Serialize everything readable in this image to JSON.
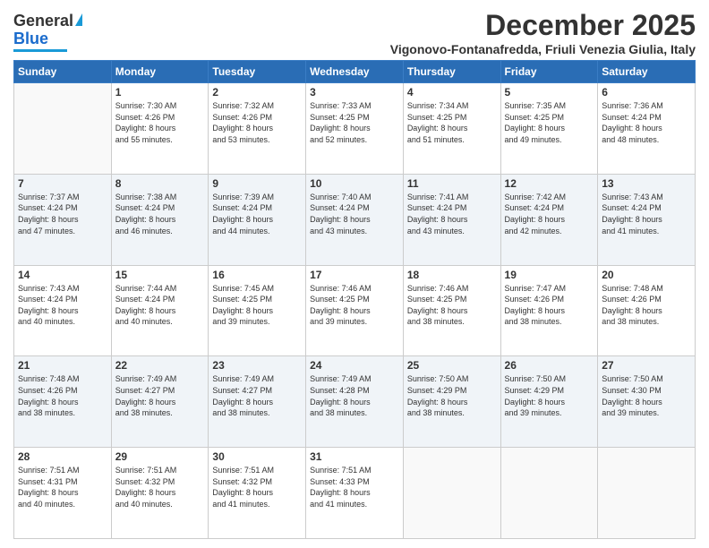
{
  "logo": {
    "line1": "General",
    "line2": "Blue"
  },
  "title": "December 2025",
  "location": "Vigonovo-Fontanafredda, Friuli Venezia Giulia, Italy",
  "days_header": [
    "Sunday",
    "Monday",
    "Tuesday",
    "Wednesday",
    "Thursday",
    "Friday",
    "Saturday"
  ],
  "weeks": [
    [
      {
        "day": "",
        "info": ""
      },
      {
        "day": "1",
        "info": "Sunrise: 7:30 AM\nSunset: 4:26 PM\nDaylight: 8 hours\nand 55 minutes."
      },
      {
        "day": "2",
        "info": "Sunrise: 7:32 AM\nSunset: 4:26 PM\nDaylight: 8 hours\nand 53 minutes."
      },
      {
        "day": "3",
        "info": "Sunrise: 7:33 AM\nSunset: 4:25 PM\nDaylight: 8 hours\nand 52 minutes."
      },
      {
        "day": "4",
        "info": "Sunrise: 7:34 AM\nSunset: 4:25 PM\nDaylight: 8 hours\nand 51 minutes."
      },
      {
        "day": "5",
        "info": "Sunrise: 7:35 AM\nSunset: 4:25 PM\nDaylight: 8 hours\nand 49 minutes."
      },
      {
        "day": "6",
        "info": "Sunrise: 7:36 AM\nSunset: 4:24 PM\nDaylight: 8 hours\nand 48 minutes."
      }
    ],
    [
      {
        "day": "7",
        "info": "Sunrise: 7:37 AM\nSunset: 4:24 PM\nDaylight: 8 hours\nand 47 minutes."
      },
      {
        "day": "8",
        "info": "Sunrise: 7:38 AM\nSunset: 4:24 PM\nDaylight: 8 hours\nand 46 minutes."
      },
      {
        "day": "9",
        "info": "Sunrise: 7:39 AM\nSunset: 4:24 PM\nDaylight: 8 hours\nand 44 minutes."
      },
      {
        "day": "10",
        "info": "Sunrise: 7:40 AM\nSunset: 4:24 PM\nDaylight: 8 hours\nand 43 minutes."
      },
      {
        "day": "11",
        "info": "Sunrise: 7:41 AM\nSunset: 4:24 PM\nDaylight: 8 hours\nand 43 minutes."
      },
      {
        "day": "12",
        "info": "Sunrise: 7:42 AM\nSunset: 4:24 PM\nDaylight: 8 hours\nand 42 minutes."
      },
      {
        "day": "13",
        "info": "Sunrise: 7:43 AM\nSunset: 4:24 PM\nDaylight: 8 hours\nand 41 minutes."
      }
    ],
    [
      {
        "day": "14",
        "info": "Sunrise: 7:43 AM\nSunset: 4:24 PM\nDaylight: 8 hours\nand 40 minutes."
      },
      {
        "day": "15",
        "info": "Sunrise: 7:44 AM\nSunset: 4:24 PM\nDaylight: 8 hours\nand 40 minutes."
      },
      {
        "day": "16",
        "info": "Sunrise: 7:45 AM\nSunset: 4:25 PM\nDaylight: 8 hours\nand 39 minutes."
      },
      {
        "day": "17",
        "info": "Sunrise: 7:46 AM\nSunset: 4:25 PM\nDaylight: 8 hours\nand 39 minutes."
      },
      {
        "day": "18",
        "info": "Sunrise: 7:46 AM\nSunset: 4:25 PM\nDaylight: 8 hours\nand 38 minutes."
      },
      {
        "day": "19",
        "info": "Sunrise: 7:47 AM\nSunset: 4:26 PM\nDaylight: 8 hours\nand 38 minutes."
      },
      {
        "day": "20",
        "info": "Sunrise: 7:48 AM\nSunset: 4:26 PM\nDaylight: 8 hours\nand 38 minutes."
      }
    ],
    [
      {
        "day": "21",
        "info": "Sunrise: 7:48 AM\nSunset: 4:26 PM\nDaylight: 8 hours\nand 38 minutes."
      },
      {
        "day": "22",
        "info": "Sunrise: 7:49 AM\nSunset: 4:27 PM\nDaylight: 8 hours\nand 38 minutes."
      },
      {
        "day": "23",
        "info": "Sunrise: 7:49 AM\nSunset: 4:27 PM\nDaylight: 8 hours\nand 38 minutes."
      },
      {
        "day": "24",
        "info": "Sunrise: 7:49 AM\nSunset: 4:28 PM\nDaylight: 8 hours\nand 38 minutes."
      },
      {
        "day": "25",
        "info": "Sunrise: 7:50 AM\nSunset: 4:29 PM\nDaylight: 8 hours\nand 38 minutes."
      },
      {
        "day": "26",
        "info": "Sunrise: 7:50 AM\nSunset: 4:29 PM\nDaylight: 8 hours\nand 39 minutes."
      },
      {
        "day": "27",
        "info": "Sunrise: 7:50 AM\nSunset: 4:30 PM\nDaylight: 8 hours\nand 39 minutes."
      }
    ],
    [
      {
        "day": "28",
        "info": "Sunrise: 7:51 AM\nSunset: 4:31 PM\nDaylight: 8 hours\nand 40 minutes."
      },
      {
        "day": "29",
        "info": "Sunrise: 7:51 AM\nSunset: 4:32 PM\nDaylight: 8 hours\nand 40 minutes."
      },
      {
        "day": "30",
        "info": "Sunrise: 7:51 AM\nSunset: 4:32 PM\nDaylight: 8 hours\nand 41 minutes."
      },
      {
        "day": "31",
        "info": "Sunrise: 7:51 AM\nSunset: 4:33 PM\nDaylight: 8 hours\nand 41 minutes."
      },
      {
        "day": "",
        "info": ""
      },
      {
        "day": "",
        "info": ""
      },
      {
        "day": "",
        "info": ""
      }
    ]
  ]
}
